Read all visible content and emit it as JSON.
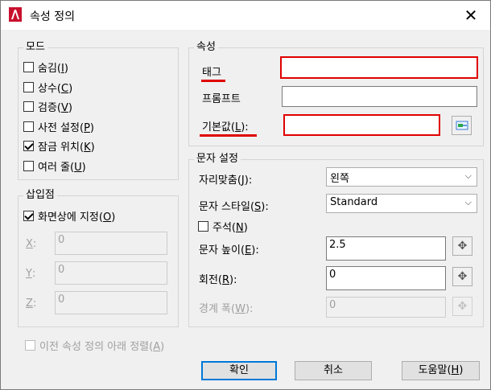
{
  "window": {
    "title": "속성 정의",
    "close_glyph": "✕"
  },
  "mode": {
    "title": "모드",
    "items": [
      {
        "text": "숨김",
        "hot": "I",
        "checked": false
      },
      {
        "text": "상수",
        "hot": "C",
        "checked": false
      },
      {
        "text": "검증",
        "hot": "V",
        "checked": false
      },
      {
        "text": "사전 설정",
        "hot": "P",
        "checked": false
      },
      {
        "text": "잠금 위치",
        "hot": "K",
        "checked": true
      },
      {
        "text": "여러 줄",
        "hot": "U",
        "checked": false
      }
    ]
  },
  "insert": {
    "title": "삽입점",
    "specify": {
      "text": "화면상에 지정",
      "hot": "O",
      "checked": true
    },
    "x": {
      "label": "X",
      "suffix": ":",
      "value": "0"
    },
    "y": {
      "label": "Y",
      "suffix": ":",
      "value": "0"
    },
    "z": {
      "label": "Z",
      "suffix": ":",
      "value": "0"
    }
  },
  "attribute": {
    "title": "속성",
    "tag_label": "태그",
    "tag_value": "",
    "prompt_label": "프롬프트",
    "prompt_value": "",
    "default_label": "기본값",
    "default_hot": "L",
    "default_suffix": "):",
    "default_value": ""
  },
  "text": {
    "title": "문자 설정",
    "justify": {
      "label": "자리맞춤",
      "hot": "J",
      "suffix": "):",
      "value": "왼쪽"
    },
    "style": {
      "label": "문자 스타일",
      "hot": "S",
      "suffix": "):",
      "value": "Standard"
    },
    "annotative": {
      "text": "주석",
      "hot": "N",
      "checked": false
    },
    "height": {
      "label": "문자 높이",
      "hot": "E",
      "suffix": "):",
      "value": "2.5"
    },
    "rotation": {
      "label": "회전",
      "hot": "R",
      "suffix": "):",
      "value": "0"
    },
    "width": {
      "label": "경계 폭",
      "hot": "W",
      "suffix": "):",
      "value": "0"
    }
  },
  "align_below": {
    "text": "이전 속성 정의 아래 정렬",
    "hot": "A",
    "checked": false
  },
  "buttons": {
    "ok": "확인",
    "cancel": "취소",
    "help": "도움말",
    "help_hot": "H"
  },
  "colors": {
    "highlight": "#e00000",
    "accent": "#0078d7"
  }
}
